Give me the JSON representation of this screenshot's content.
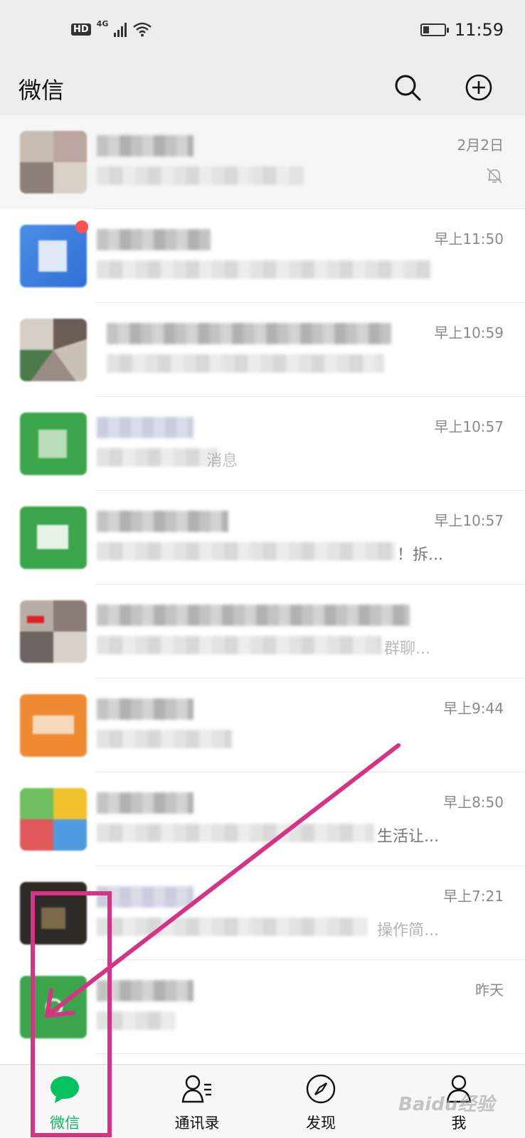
{
  "status_bar": {
    "hd": "HD",
    "network": "4G",
    "time": "11:59"
  },
  "header": {
    "title": "微信"
  },
  "chats": [
    {
      "time": "2月2日",
      "muted": true
    },
    {
      "time": "早上11:50",
      "unread_dot": true
    },
    {
      "time": "早上10:59"
    },
    {
      "time": "早上10:57",
      "msg_tail": "消息"
    },
    {
      "time": "早上10:57",
      "msg_tail": "！拆..."
    },
    {
      "time": "",
      "msg_tail": "群聊..."
    },
    {
      "time": "早上9:44"
    },
    {
      "time": "早上8:50",
      "msg_tail": "生活让..."
    },
    {
      "time": "早上7:21",
      "msg_tail": "操作简..."
    },
    {
      "time": "昨天"
    }
  ],
  "tabs": [
    {
      "label": "微信",
      "icon": "chat-bubble-icon",
      "active": true
    },
    {
      "label": "通讯录",
      "icon": "contacts-icon"
    },
    {
      "label": "发现",
      "icon": "compass-icon"
    },
    {
      "label": "我",
      "icon": "person-icon"
    }
  ],
  "watermark": "Baidu经验",
  "colors": {
    "accent": "#07c160",
    "annotation": "#d63384",
    "header_bg": "#ededed"
  }
}
